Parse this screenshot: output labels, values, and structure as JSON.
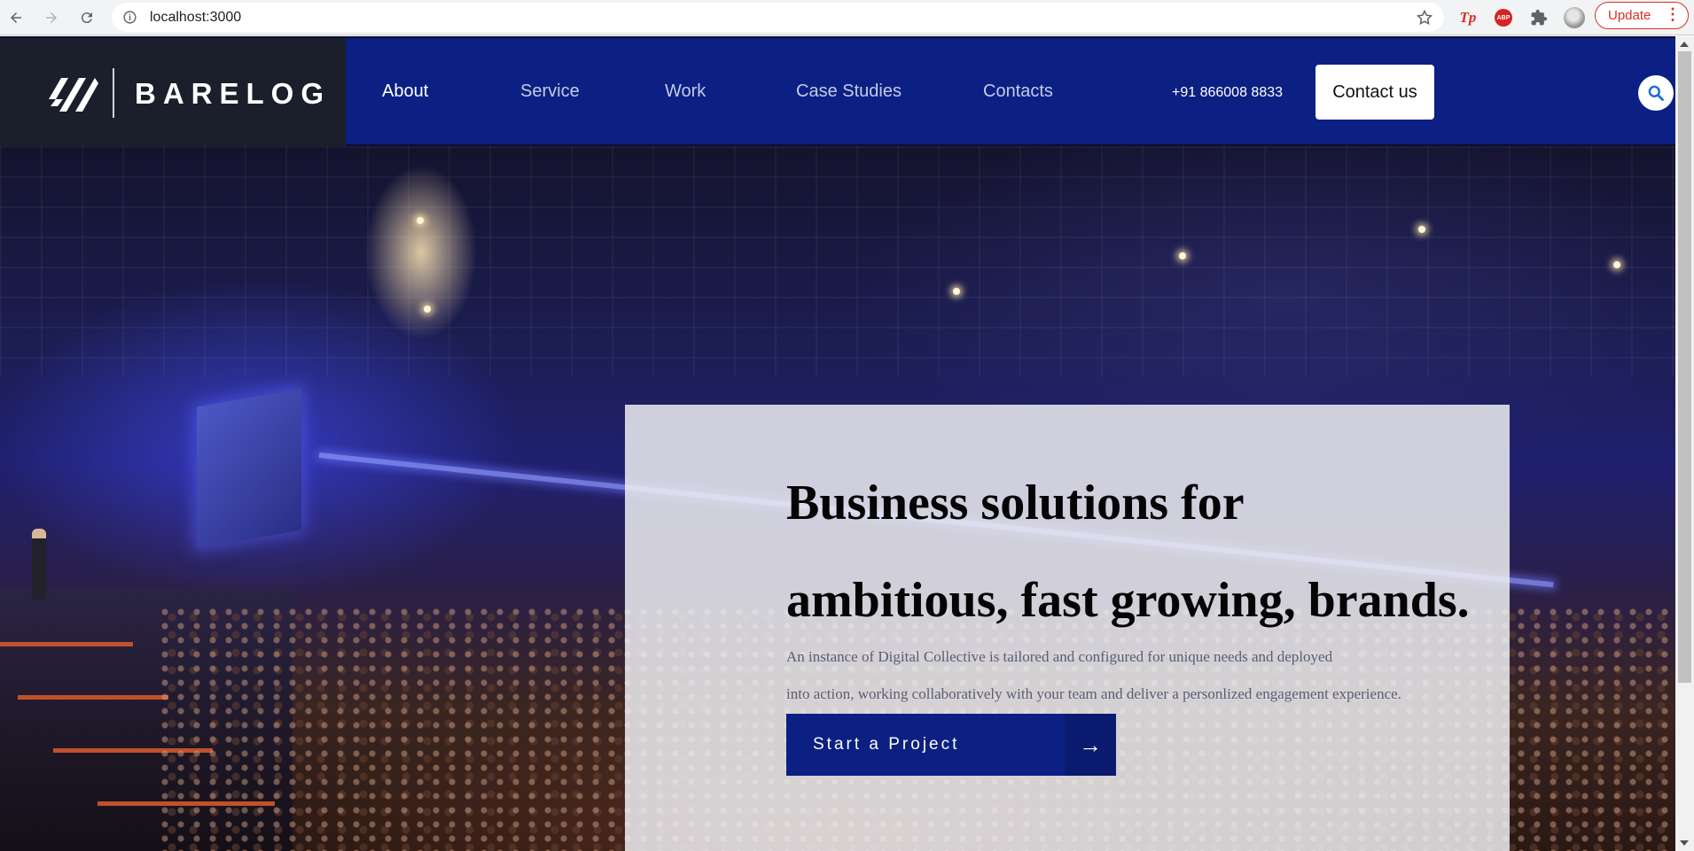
{
  "browser": {
    "url": "localhost:3000",
    "update_label": "Update",
    "extensions": {
      "tp_label": "Tp",
      "abp_label": "ABP"
    }
  },
  "site": {
    "brand": "BARELOG",
    "nav": [
      {
        "label": "About",
        "active": true
      },
      {
        "label": "Service",
        "active": false
      },
      {
        "label": "Work",
        "active": false
      },
      {
        "label": "Case Studies",
        "active": false
      },
      {
        "label": "Contacts",
        "active": false
      }
    ],
    "phone": "+91 866008 8833",
    "contact_button": "Contact us",
    "colors": {
      "header_bg": "#0b2082",
      "brand_bg": "#1b1f2b",
      "cta_bg": "#0b2082"
    }
  },
  "hero": {
    "title_line1": "Business solutions for",
    "title_line2": "ambitious, fast growing, brands.",
    "desc_line1": "An instance of Digital Collective is tailored and configured for unique needs and deployed",
    "desc_line2": "into action, working collaboratively with your team and deliver a personlized engagement experience.",
    "cta_label": "Start a Project",
    "cta_arrow": "→",
    "background": "conference-hall-photo"
  }
}
